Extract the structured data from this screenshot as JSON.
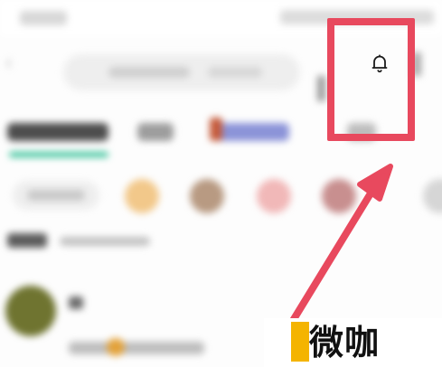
{
  "watermark": {
    "text": "微咖",
    "accent_color": "#f4b400"
  },
  "header": {
    "back_icon": "chevron-left-icon",
    "notification_icon": "bell-icon"
  },
  "tabs": {
    "active_indicator_color": "#38c39a"
  },
  "annotation": {
    "highlight_color": "#e8495e",
    "arrow_color": "#e8495e"
  }
}
